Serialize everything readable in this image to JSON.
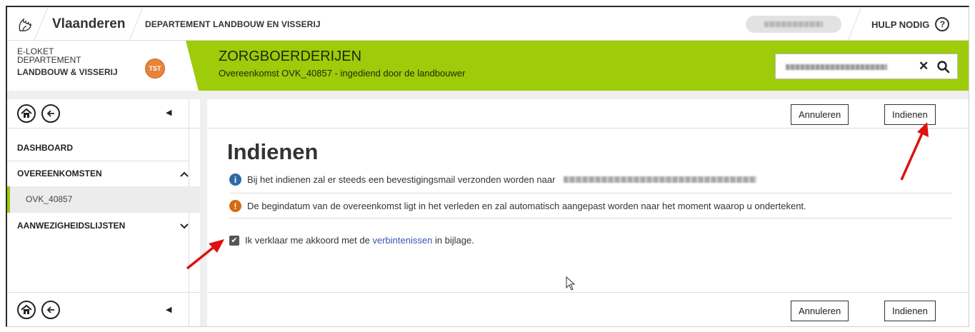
{
  "topbar": {
    "brand": "Vlaanderen",
    "department": "DEPARTEMENT LANDBOUW EN VISSERIJ",
    "help_label": "HULP NODIG",
    "help_icon": "question-circle-icon"
  },
  "portal": {
    "line1": "E-LOKET",
    "line2": "DEPARTEMENT",
    "line3": "LANDBOUW & VISSERIJ",
    "env_badge": "TST",
    "env_badge_color": "#e8833a"
  },
  "app": {
    "title": "ZORGBOERDERIJEN",
    "subtitle": "Overeenkomst OVK_40857 - ingediend door de landbouwer",
    "accent_color": "#9ecb0a"
  },
  "sidebar": {
    "items": [
      {
        "label": "DASHBOARD"
      },
      {
        "label": "OVEREENKOMSTEN",
        "expanded": true
      },
      {
        "label": "OVK_40857"
      },
      {
        "label": "AANWEZIGHEIDSLIJSTEN",
        "expanded": false
      }
    ]
  },
  "main": {
    "heading": "Indienen",
    "cancel_label": "Annuleren",
    "submit_label": "Indienen",
    "info_message": "Bij het indienen zal er steeds een bevestigingsmail verzonden worden naar",
    "warning_message": "De begindatum van de overeenkomst ligt in het verleden en zal automatisch aangepast worden naar het moment waarop u ondertekent.",
    "checkbox": {
      "checked": true,
      "text_before": "Ik verklaar me akkoord met de",
      "link_text": "verbintenissen",
      "text_after": "in bijlage."
    },
    "info_color": "#2d6aa8",
    "warning_color": "#d56a12",
    "link_color": "#3a54b4",
    "annotation_color": "#e01010"
  }
}
